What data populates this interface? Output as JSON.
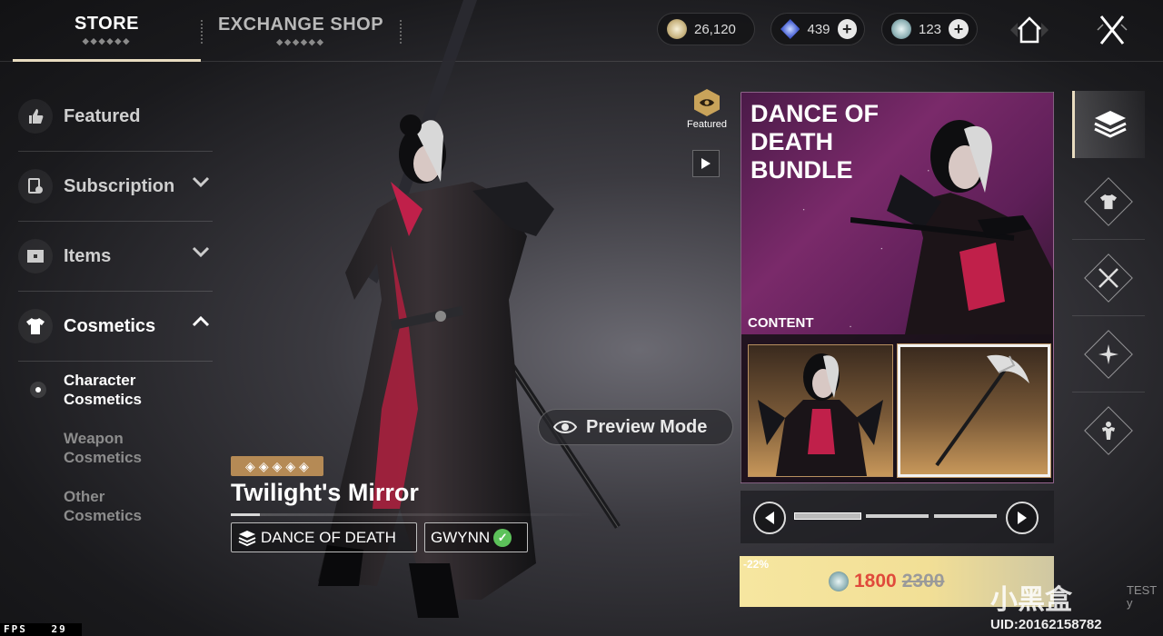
{
  "tabs": {
    "store": "STORE",
    "exchange": "EXCHANGE SHOP",
    "decoration": "◆◆◆◆◆◆"
  },
  "currencies": [
    {
      "icon": "gold-coin-icon",
      "value": "26,120"
    },
    {
      "icon": "blue-crystal-icon",
      "value": "439"
    },
    {
      "icon": "silver-coin-icon",
      "value": "123"
    }
  ],
  "sidebar": {
    "items": [
      {
        "label": "Featured",
        "icon": "thumbs-up-icon"
      },
      {
        "label": "Subscription",
        "icon": "subscription-icon"
      },
      {
        "label": "Items",
        "icon": "chest-icon"
      },
      {
        "label": "Cosmetics",
        "icon": "shirt-icon"
      }
    ],
    "subitems": [
      {
        "label": "Character\nCosmetics",
        "line1": "Character",
        "line2": "Cosmetics"
      },
      {
        "line1": "Weapon",
        "line2": "Cosmetics"
      },
      {
        "line1": "Other",
        "line2": "Cosmetics"
      }
    ]
  },
  "product": {
    "title": "Twilight's Mirror",
    "rarity_stars": 5,
    "tag_set": "DANCE OF DEATH",
    "tag_character": "GWYNN",
    "preview_label": "Preview Mode"
  },
  "featured_label": "Featured",
  "bundle": {
    "title_line1": "DANCE OF",
    "title_line2": "DEATH",
    "title_line3": "BUNDLE",
    "content_label": "CONTENT"
  },
  "price": {
    "discount": "-22%",
    "current": "1800",
    "original": "2300"
  },
  "hud": {
    "fps_label": "FPS",
    "fps_value": "29"
  },
  "watermark": {
    "logo": "小黑盒",
    "text_line1": "TEST",
    "text_line2": "y",
    "uid": "UID:20162158782"
  },
  "colors": {
    "accent": "#e8dcc0",
    "price_now": "#e04a3b",
    "rarity": "#b58a55",
    "check": "#5cc25a"
  }
}
